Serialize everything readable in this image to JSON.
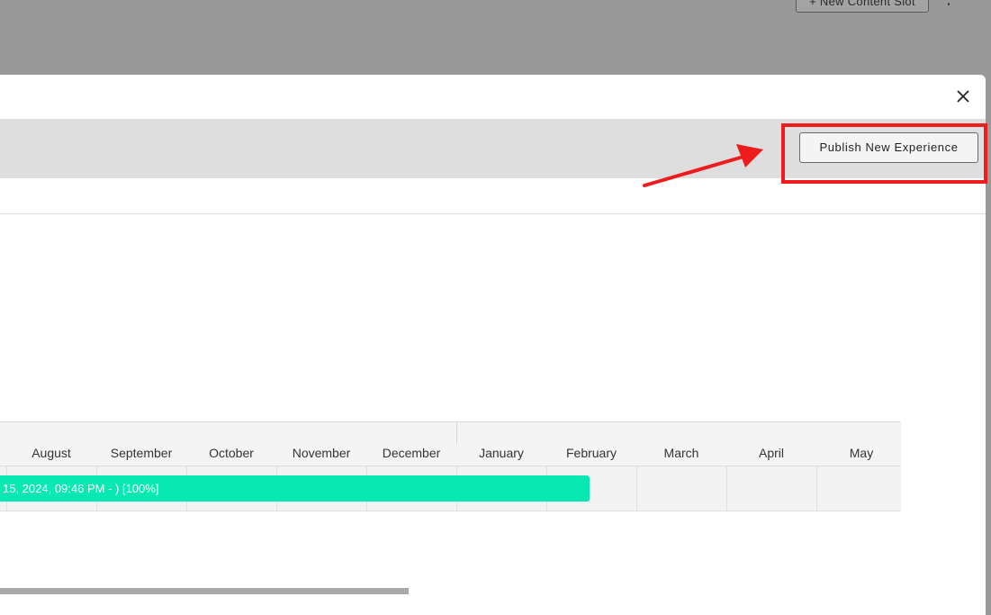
{
  "background_page": {
    "new_content_slot_label": "+ New Content Slot",
    "more_menu_glyph": "⋮"
  },
  "modal": {
    "close_glyph": "✕",
    "publish_button_label": "Publish New Experience"
  },
  "timeline": {
    "months": [
      "August",
      "September",
      "October",
      "November",
      "December",
      "January",
      "February",
      "March",
      "April",
      "May"
    ],
    "experience_bar_label": "15, 2024, 09:46 PM - ) [100%]"
  },
  "colors": {
    "overlay": "#999999",
    "bar": "#08e8b2",
    "annotation": "#ee1c1c"
  }
}
